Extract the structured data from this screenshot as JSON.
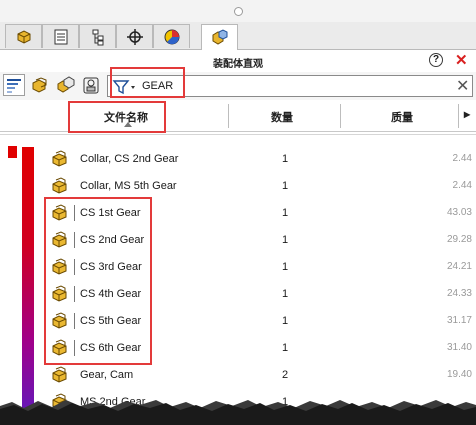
{
  "panel": {
    "title": "装配体直观",
    "help_label": "?",
    "close_label": "✕"
  },
  "tabs": [
    {
      "icon": "feature-manager-icon",
      "active": false
    },
    {
      "icon": "property-manager-icon",
      "active": false
    },
    {
      "icon": "configuration-manager-icon",
      "active": false
    },
    {
      "icon": "dimxpert-manager-icon",
      "active": false
    },
    {
      "icon": "display-manager-icon",
      "active": false
    },
    {
      "icon": "assembly-visualization-icon",
      "active": true
    }
  ],
  "toolbar": {
    "filter": {
      "value": "GEAR",
      "placeholder": ""
    },
    "clear_label": "✕"
  },
  "columns": {
    "name": "文件名称",
    "quantity": "数量",
    "mass": "质量",
    "more_label": "▸"
  },
  "rows": [
    {
      "name": "Collar, CS 2nd Gear",
      "qty": "1",
      "mass": "2.44"
    },
    {
      "name": "Collar, MS 5th Gear",
      "qty": "1",
      "mass": "2.44"
    },
    {
      "name": "CS 1st Gear",
      "qty": "1",
      "mass": "43.03"
    },
    {
      "name": "CS 2nd Gear",
      "qty": "1",
      "mass": "29.28"
    },
    {
      "name": "CS 3rd Gear",
      "qty": "1",
      "mass": "24.21"
    },
    {
      "name": "CS 4th Gear",
      "qty": "1",
      "mass": "24.33"
    },
    {
      "name": "CS 5th Gear",
      "qty": "1",
      "mass": "31.17"
    },
    {
      "name": "CS 6th Gear",
      "qty": "1",
      "mass": "31.40"
    },
    {
      "name": "Gear, Cam",
      "qty": "2",
      "mass": "19.40"
    },
    {
      "name": "MS 2nd Gear",
      "qty": "1",
      "mass": ""
    }
  ],
  "colors": {
    "annotation": "#e33a3a",
    "bar_top": "#e00000",
    "bar_bottom": "#5a1cc0"
  }
}
